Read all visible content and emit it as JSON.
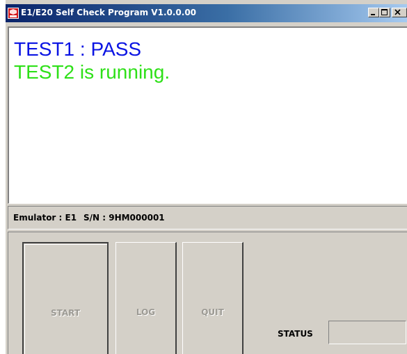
{
  "window": {
    "title": "E1/E20 Self Check Program V1.0.0.00",
    "icon": "renesas-app-icon"
  },
  "output": {
    "lines": [
      {
        "text": "TEST1 : PASS",
        "color": "#0b14e3"
      },
      {
        "text": "TEST2 is running.",
        "color": "#2ee018"
      }
    ]
  },
  "info": {
    "emulator": "Emulator : E1",
    "serial": "S/N : 9HM000001"
  },
  "buttons": {
    "start": "START",
    "log": "LOG",
    "quit": "QUIT"
  },
  "status": {
    "label": "STATUS",
    "value": ""
  }
}
